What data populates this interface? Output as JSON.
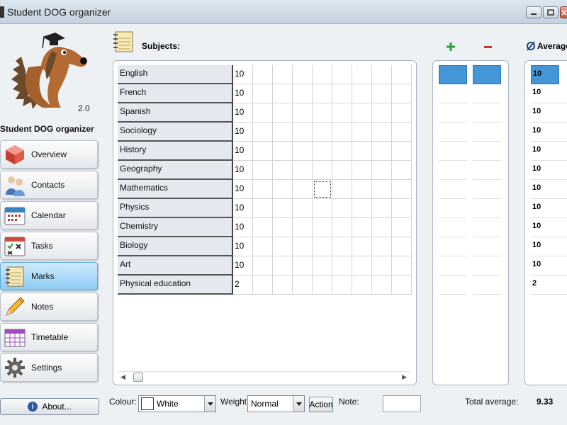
{
  "window": {
    "title": "Student DOG organizer"
  },
  "sidebar": {
    "version": "2.0",
    "app_name": "Student DOG organizer",
    "items": [
      {
        "label": "Overview",
        "icon": "cube-icon"
      },
      {
        "label": "Contacts",
        "icon": "people-icon"
      },
      {
        "label": "Calendar",
        "icon": "calendar-icon"
      },
      {
        "label": "Tasks",
        "icon": "tasks-icon"
      },
      {
        "label": "Marks",
        "icon": "notebook-icon",
        "active": true
      },
      {
        "label": "Notes",
        "icon": "pencil-icon"
      },
      {
        "label": "Timetable",
        "icon": "timetable-icon"
      },
      {
        "label": "Settings",
        "icon": "gear-icon"
      }
    ],
    "about_label": "About..."
  },
  "subjects": {
    "title": "Subjects:",
    "rows": [
      {
        "name": "English",
        "mark": "10"
      },
      {
        "name": "French",
        "mark": "10"
      },
      {
        "name": "Spanish",
        "mark": "10"
      },
      {
        "name": "Sociology",
        "mark": "10"
      },
      {
        "name": "History",
        "mark": "10"
      },
      {
        "name": "Geography",
        "mark": "10"
      },
      {
        "name": "Mathematics",
        "mark": "10"
      },
      {
        "name": "Physics",
        "mark": "10"
      },
      {
        "name": "Chemistry",
        "mark": "10"
      },
      {
        "name": "Biology",
        "mark": "10"
      },
      {
        "name": "Art",
        "mark": "10"
      },
      {
        "name": "Physical education",
        "mark": "2"
      }
    ]
  },
  "average": {
    "title": "Average",
    "values": [
      "10",
      "10",
      "10",
      "10",
      "10",
      "10",
      "10",
      "10",
      "10",
      "10",
      "10",
      "2"
    ]
  },
  "bottom": {
    "colour_label": "Colour:",
    "colour_value": "White",
    "weight_label": "Weight:",
    "weight_value": "Normal",
    "action_label": "Action",
    "note_label": "Note:",
    "note_value": "",
    "total_label": "Total average:",
    "total_value": "9.33"
  },
  "colors": {
    "accent": "#4496d8",
    "plus": "#2ea043",
    "minus": "#c0392b",
    "active_nav": "#8ccbf2"
  }
}
